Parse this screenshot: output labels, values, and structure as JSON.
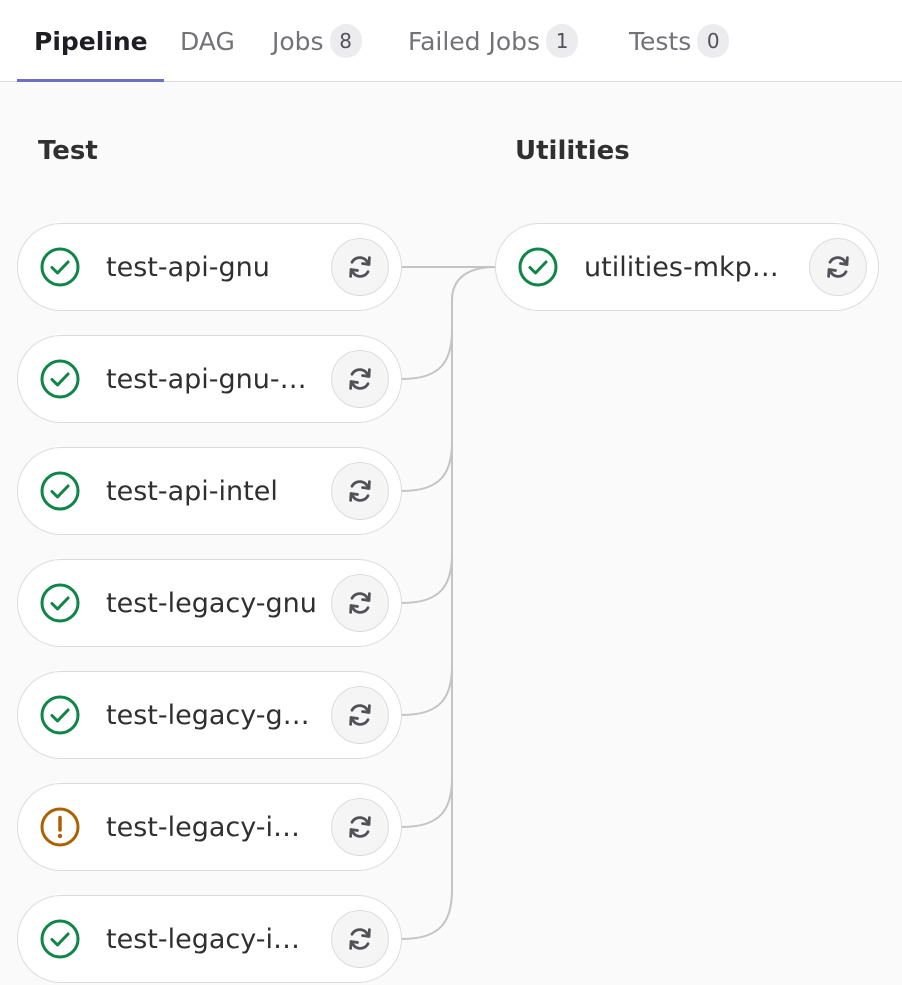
{
  "tabs": [
    {
      "label": "Pipeline",
      "badge": null,
      "active": true
    },
    {
      "label": "DAG",
      "badge": null,
      "active": false
    },
    {
      "label": "Jobs",
      "badge": "8",
      "active": false
    },
    {
      "label": "Failed Jobs",
      "badge": "1",
      "active": false
    },
    {
      "label": "Tests",
      "badge": "0",
      "active": false
    }
  ],
  "stages": [
    {
      "title": "Test",
      "jobs": [
        {
          "name": "test-api-gnu",
          "status": "success"
        },
        {
          "name": "test-api-gnu-…",
          "status": "success"
        },
        {
          "name": "test-api-intel",
          "status": "success"
        },
        {
          "name": "test-legacy-gnu",
          "status": "success"
        },
        {
          "name": "test-legacy-g…",
          "status": "success"
        },
        {
          "name": "test-legacy-i…",
          "status": "warning"
        },
        {
          "name": "test-legacy-i…",
          "status": "success"
        }
      ]
    },
    {
      "title": "Utilities",
      "jobs": [
        {
          "name": "utilities-mkp…",
          "status": "success"
        }
      ]
    }
  ],
  "colors": {
    "success": "#108548",
    "warning": "#ab6100",
    "accent": "#6b70c2",
    "border": "#dcdcde",
    "retry_icon": "#535158"
  },
  "icons": {
    "success": "check-circle-icon",
    "warning": "exclamation-circle-icon",
    "retry": "retry-icon"
  }
}
